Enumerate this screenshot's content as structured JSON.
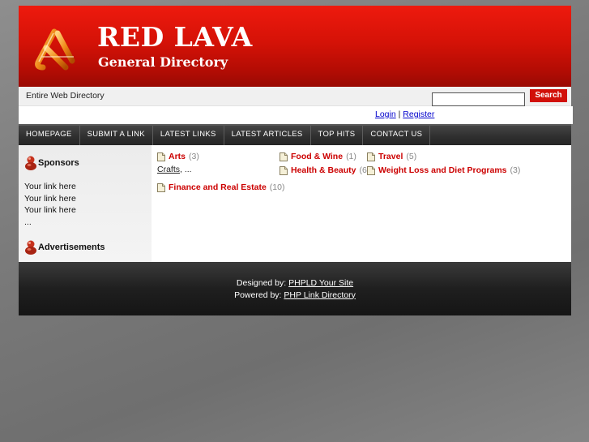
{
  "header": {
    "title": "RED LAVA",
    "subtitle": "General Directory"
  },
  "search": {
    "scope_label": "Entire Web Directory",
    "input_value": "",
    "button_label": "Search"
  },
  "auth": {
    "login_label": "Login",
    "separator": "|",
    "register_label": "Register"
  },
  "nav": {
    "items": [
      "HOMEPAGE",
      "SUBMIT A LINK",
      "LATEST LINKS",
      "LATEST ARTICLES",
      "TOP HITS",
      "CONTACT US"
    ]
  },
  "sidebar": {
    "sponsors_title": "Sponsors",
    "links": [
      "Your link here",
      "Your link here",
      "Your link here",
      "..."
    ],
    "ads_title": "Advertisements"
  },
  "categories": [
    {
      "name": "Arts",
      "count": "(3)"
    },
    {
      "name": "Food & Wine",
      "count": "(1)"
    },
    {
      "name": "Travel",
      "count": "(5)"
    },
    {
      "name": "Health & Beauty",
      "count": "(6)"
    },
    {
      "name": "Weight Loss and Diet Programs",
      "count": "(3)"
    },
    {
      "name": "Finance and Real Estate",
      "count": "(10)"
    }
  ],
  "subcategories": {
    "link": "Crafts",
    "suffix": ", ..."
  },
  "footer": {
    "designed_prefix": "Designed by:",
    "designed_link": "PHPLD Your Site",
    "powered_prefix": "Powered by:",
    "powered_link": "PHP Link Directory"
  },
  "colors": {
    "brand_red": "#d51207",
    "category_red": "#cc0000",
    "nav_dark": "#2e2e2e"
  },
  "icons": {
    "logo": "red-lava-logo-icon",
    "pin": "pushpin-icon",
    "folder": "folder-icon"
  }
}
